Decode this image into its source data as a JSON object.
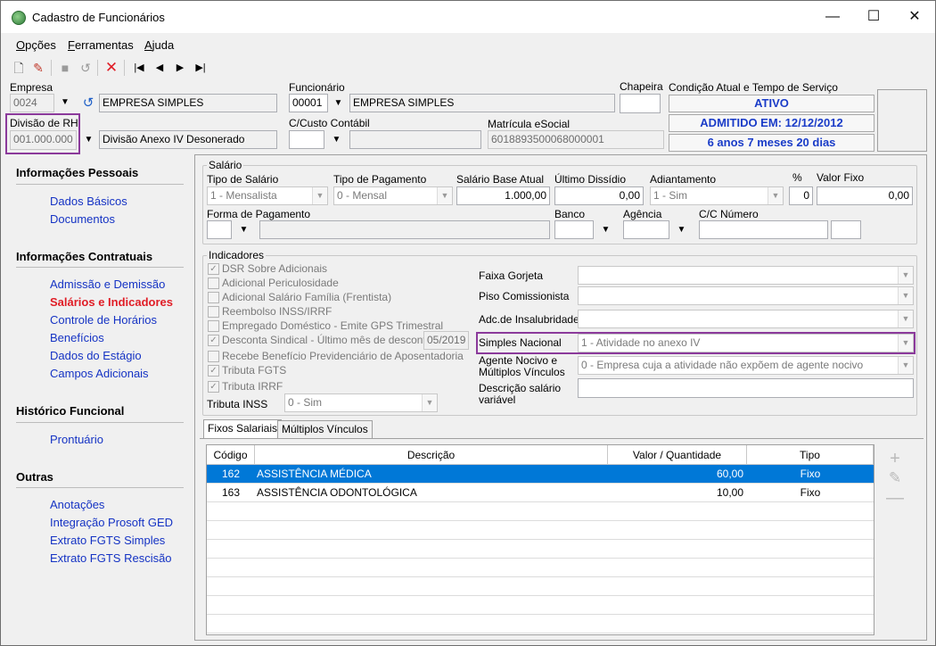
{
  "window": {
    "title": "Cadastro de Funcionários"
  },
  "menu": [
    {
      "label": "Opções",
      "ul": "O",
      "rest": "pções"
    },
    {
      "label": "Ferramentas",
      "ul": "F",
      "rest": "erramentas"
    },
    {
      "label": "Ajuda",
      "ul": "A",
      "rest": "juda"
    }
  ],
  "header": {
    "empresa_label": "Empresa",
    "empresa_code": "0024",
    "empresa_name": "EMPRESA SIMPLES",
    "funcionario_label": "Funcionário",
    "funcionario_code": "00001",
    "funcionario_name": "EMPRESA SIMPLES",
    "chapeira_label": "Chapeira",
    "condicao_label": "Condição Atual e Tempo de Serviço",
    "status": "ATIVO",
    "admitido": "ADMITIDO EM: 12/12/2012",
    "tempo": "6 anos 7 meses 20 dias",
    "divisao_label": "Divisão de RH",
    "divisao_code": "001.000.000",
    "divisao_name": "Divisão Anexo IV Desonerado",
    "ccusto_label": "C/Custo Contábil",
    "matricula_label": "Matrícula eSocial",
    "matricula_value": "6018893500068000001"
  },
  "sidebar": {
    "sections": [
      {
        "title": "Informações Pessoais",
        "items": [
          "Dados Básicos",
          "Documentos"
        ]
      },
      {
        "title": "Informações Contratuais",
        "items": [
          "Admissão e Demissão",
          "Salários e Indicadores",
          "Controle de Horários",
          "Benefícios",
          "Dados do Estágio",
          "Campos Adicionais"
        ]
      },
      {
        "title": "Histórico Funcional",
        "items": [
          "Prontuário"
        ]
      },
      {
        "title": "Outras",
        "items": [
          "Anotações",
          "Integração Prosoft GED",
          "Extrato FGTS Simples",
          "Extrato FGTS Rescisão"
        ]
      }
    ],
    "active": "Salários e Indicadores"
  },
  "salario": {
    "group": "Salário",
    "tipo_salario_label": "Tipo de Salário",
    "tipo_salario": "1 - Mensalista",
    "tipo_pagamento_label": "Tipo de Pagamento",
    "tipo_pagamento": "0 - Mensal",
    "salario_base_label": "Salário Base Atual",
    "salario_base": "1.000,00",
    "ultimo_dissidio_label": "Último Dissídio",
    "ultimo_dissidio": "0,00",
    "adiantamento_label": "Adiantamento",
    "adiantamento": "1 - Sim",
    "percent_label": "%",
    "percent": "0",
    "valor_fixo_label": "Valor Fixo",
    "valor_fixo": "0,00",
    "forma_pagamento_label": "Forma de Pagamento",
    "banco_label": "Banco",
    "agencia_label": "Agência",
    "cc_label": "C/C Número"
  },
  "indicadores": {
    "group": "Indicadores",
    "checks": [
      {
        "label": "DSR Sobre Adicionais",
        "checked": true
      },
      {
        "label": "Adicional Periculosidade",
        "checked": false
      },
      {
        "label": "Adicional Salário Família (Frentista)",
        "checked": false
      },
      {
        "label": "Reembolso INSS/IRRF",
        "checked": false
      },
      {
        "label": "Empregado Doméstico - Emite GPS Trimestral",
        "checked": false
      },
      {
        "label": "Desconta Sindical - Último mês de desconto",
        "checked": true
      },
      {
        "label": "Recebe Benefício Previdenciário de Aposentadoria",
        "checked": false
      },
      {
        "label": "Tributa FGTS",
        "checked": true
      },
      {
        "label": "Tributa IRRF",
        "checked": true
      }
    ],
    "desconto_mes": "05/2019",
    "tributa_inss_label": "Tributa INSS",
    "tributa_inss": "0 - Sim",
    "faixa_gorjeta_label": "Faixa Gorjeta",
    "piso_label": "Piso Comissionista",
    "insalubridade_label": "Adc.de Insalubridade",
    "simples_label": "Simples Nacional",
    "simples_value": "1 - Atividade no anexo IV",
    "agente_label_1": "Agente Nocivo e",
    "agente_label_2": "Múltiplos Vínculos",
    "agente_value": "0 - Empresa cuja a atividade não expõem de agente nocivo",
    "descricao_label_1": "Descrição salário",
    "descricao_label_2": "variável"
  },
  "tabs": [
    "Fixos Salariais",
    "Múltiplos Vínculos"
  ],
  "table": {
    "columns": [
      "Código",
      "Descrição",
      "Valor / Quantidade",
      "Tipo"
    ],
    "rows": [
      {
        "codigo": "162",
        "descricao": "ASSISTÊNCIA MÉDICA",
        "valor": "60,00",
        "tipo": "Fixo"
      },
      {
        "codigo": "163",
        "descricao": "ASSISTÊNCIA ODONTOLÓGICA",
        "valor": "10,00",
        "tipo": "Fixo"
      }
    ]
  },
  "icons": {
    "toolbar": [
      "new-doc-icon",
      "edit-icon",
      "save-icon",
      "undo-icon",
      "delete-icon",
      "first-icon",
      "prev-icon",
      "next-icon",
      "last-icon"
    ],
    "grid_actions": [
      "plus-icon",
      "pencil-icon",
      "minus-icon"
    ]
  },
  "colors": {
    "accent_blue": "#1533c4",
    "active_red": "#e01d26",
    "highlight_purple": "#8b3a9b",
    "selection": "#0078d7"
  }
}
